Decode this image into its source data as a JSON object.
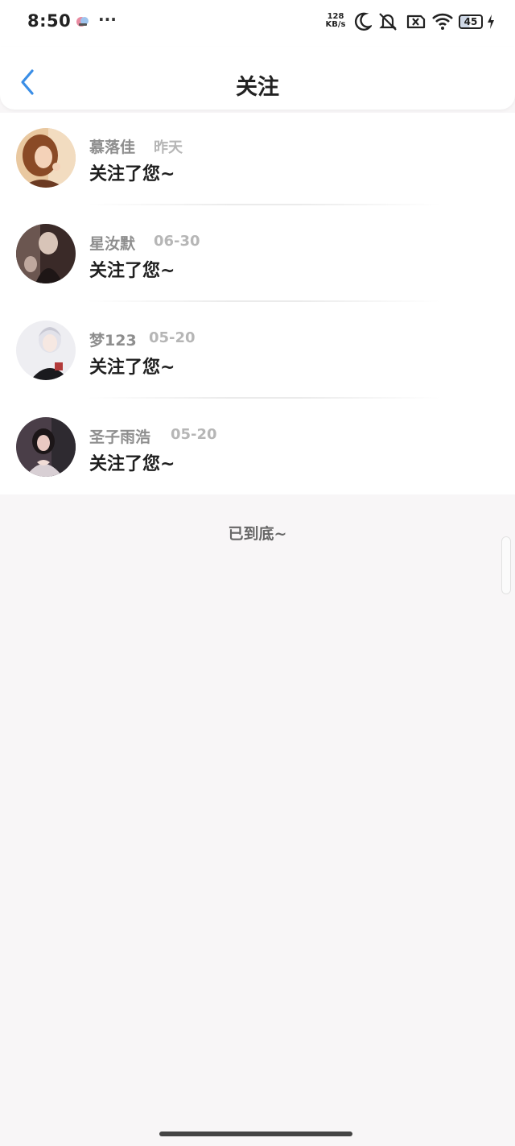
{
  "status_bar": {
    "time": "8:50",
    "more": "···",
    "net_speed_value": "128",
    "net_speed_unit": "KB/s",
    "battery": "45",
    "icons": [
      "app-notification-icon",
      "moon-icon",
      "mute-icon",
      "sim-disabled-icon",
      "wifi-icon",
      "battery-icon",
      "charging-icon"
    ]
  },
  "header": {
    "title": "关注",
    "back_icon": "chevron-left-icon",
    "accent_color": "#3a8ee6"
  },
  "followers": [
    {
      "name": "慕落佳",
      "date": "昨天",
      "message": "关注了您~"
    },
    {
      "name": "星汝默",
      "date": "06-30",
      "message": "关注了您~"
    },
    {
      "name": "梦123",
      "date": "05-20",
      "message": "关注了您~"
    },
    {
      "name": "圣子雨浩",
      "date": "05-20",
      "message": "关注了您~"
    }
  ],
  "footer": {
    "end_text": "已到底~"
  }
}
